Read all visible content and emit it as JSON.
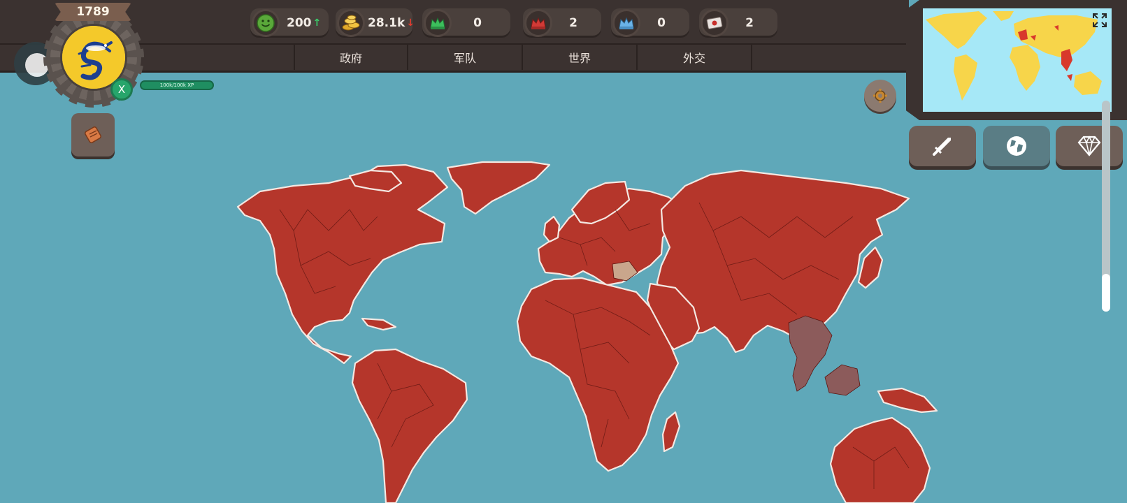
{
  "player": {
    "year": "1789",
    "close_label": "X",
    "xp_label": "100k/100k XP"
  },
  "resources": [
    {
      "name": "happiness",
      "icon": "smiley-icon",
      "value": "200",
      "trend": "up",
      "trend_glyph": "↑"
    },
    {
      "name": "gold",
      "icon": "gold-coins-icon",
      "value": "28.1k",
      "trend": "down",
      "trend_glyph": "↓"
    },
    {
      "name": "green-crown",
      "icon": "green-crown-icon",
      "value": "0"
    },
    {
      "name": "red-crown",
      "icon": "red-crown-icon",
      "value": "2"
    },
    {
      "name": "blue-crown",
      "icon": "blue-crown-icon",
      "value": "0"
    },
    {
      "name": "flag",
      "icon": "flag-icon",
      "value": "2"
    }
  ],
  "tabs": [
    {
      "label": "政府"
    },
    {
      "label": "军队"
    },
    {
      "label": "世界"
    },
    {
      "label": "外交"
    }
  ],
  "side_buttons": [
    {
      "name": "army",
      "icon": "sword-icon",
      "active": false
    },
    {
      "name": "world",
      "icon": "globe-icon",
      "active": true
    },
    {
      "name": "premium",
      "icon": "diamond-icon",
      "active": false
    }
  ],
  "colors": {
    "ocean": "#5fa8b9",
    "owned_land": "#b5362b",
    "other_land": "#8c5b5b",
    "minimap_ocean": "#a6e8f7",
    "minimap_land": "#f7d54a",
    "minimap_owned": "#d8392c",
    "positive": "#3ad06b",
    "negative": "#e23b2f"
  }
}
